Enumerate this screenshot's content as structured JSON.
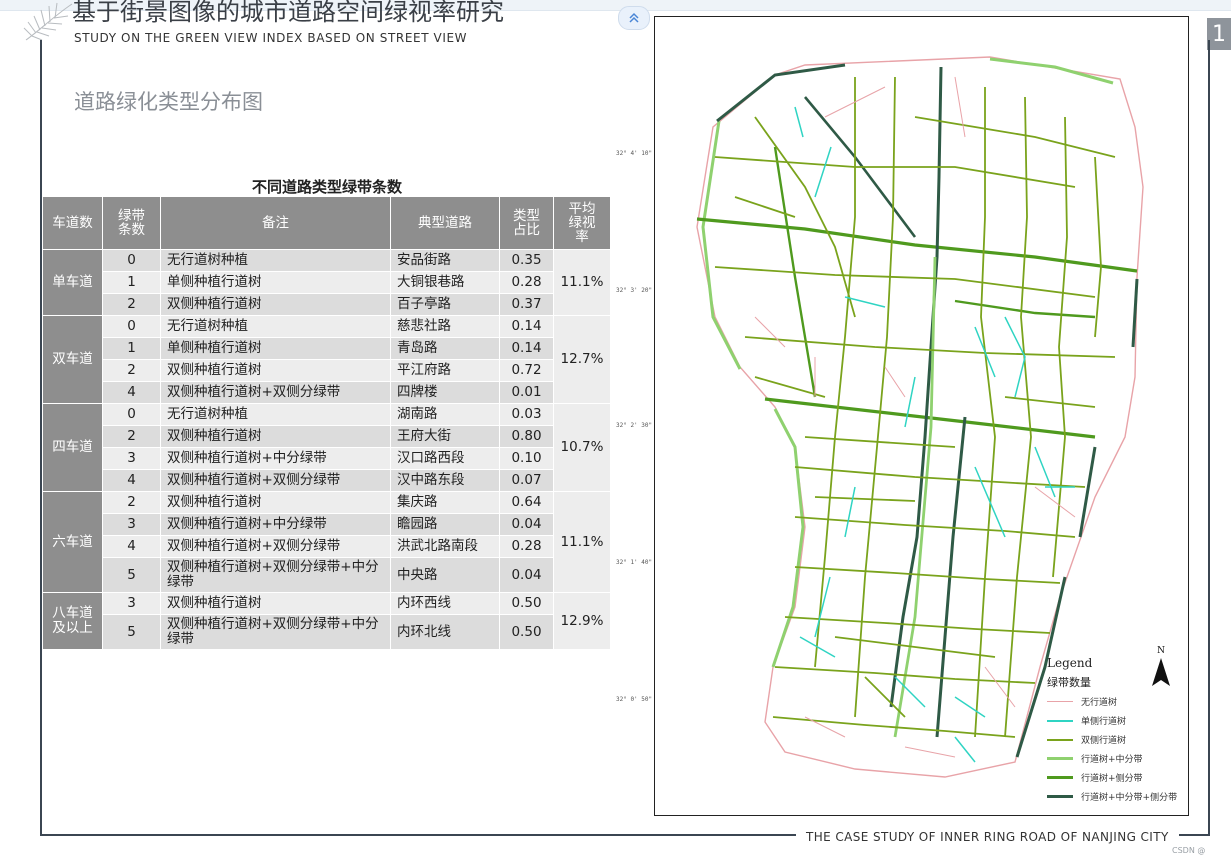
{
  "header": {
    "title_cn": "基于街景图像的城市道路空间绿视率研究",
    "title_en": "STUDY ON THE GREEN VIEW INDEX BASED ON STREET VIEW",
    "section_title": "道路绿化类型分布图",
    "page_badge": "1"
  },
  "table": {
    "title": "不同道路类型绿带条数",
    "headers": [
      "车道数",
      "绿带条数",
      "备注",
      "典型道路",
      "类型占比",
      "平均绿视率"
    ],
    "groups": [
      {
        "lane": "单车道",
        "avg": "11.1%",
        "rows": [
          {
            "belts": "0",
            "note": "无行道树种植",
            "road": "安品街路",
            "ratio": "0.35"
          },
          {
            "belts": "1",
            "note": "单侧种植行道树",
            "road": "大铜银巷路",
            "ratio": "0.28"
          },
          {
            "belts": "2",
            "note": "双侧种植行道树",
            "road": "百子亭路",
            "ratio": "0.37"
          }
        ]
      },
      {
        "lane": "双车道",
        "avg": "12.7%",
        "rows": [
          {
            "belts": "0",
            "note": "无行道树种植",
            "road": "慈悲社路",
            "ratio": "0.14"
          },
          {
            "belts": "1",
            "note": "单侧种植行道树",
            "road": "青岛路",
            "ratio": "0.14"
          },
          {
            "belts": "2",
            "note": "双侧种植行道树",
            "road": "平江府路",
            "ratio": "0.72"
          },
          {
            "belts": "4",
            "note": "双侧种植行道树+双侧分绿带",
            "road": "四牌楼",
            "ratio": "0.01"
          }
        ]
      },
      {
        "lane": "四车道",
        "avg": "10.7%",
        "rows": [
          {
            "belts": "0",
            "note": "无行道树种植",
            "road": "湖南路",
            "ratio": "0.03"
          },
          {
            "belts": "2",
            "note": "双侧种植行道树",
            "road": "王府大街",
            "ratio": "0.80"
          },
          {
            "belts": "3",
            "note": "双侧种植行道树+中分绿带",
            "road": "汉口路西段",
            "ratio": "0.10"
          },
          {
            "belts": "4",
            "note": "双侧种植行道树+双侧分绿带",
            "road": "汉中路东段",
            "ratio": "0.07"
          }
        ]
      },
      {
        "lane": "六车道",
        "avg": "11.1%",
        "rows": [
          {
            "belts": "2",
            "note": "双侧种植行道树",
            "road": "集庆路",
            "ratio": "0.64"
          },
          {
            "belts": "3",
            "note": "双侧种植行道树+中分绿带",
            "road": "瞻园路",
            "ratio": "0.04"
          },
          {
            "belts": "4",
            "note": "双侧种植行道树+双侧分绿带",
            "road": "洪武北路南段",
            "ratio": "0.28"
          },
          {
            "belts": "5",
            "note": "双侧种植行道树+双侧分绿带+中分绿带",
            "road": "中央路",
            "ratio": "0.04"
          }
        ]
      },
      {
        "lane": "八车道及以上",
        "avg": "12.9%",
        "rows": [
          {
            "belts": "3",
            "note": "双侧种植行道树",
            "road": "内环西线",
            "ratio": "0.50"
          },
          {
            "belts": "5",
            "note": "双侧种植行道树+双侧分绿带+中分绿带",
            "road": "内环北线",
            "ratio": "0.50"
          }
        ]
      }
    ]
  },
  "map": {
    "lat_labels": [
      "32° 4' 10\" N",
      "32° 3' 20\" N",
      "32° 2' 30\" N",
      "32° 1' 40\" N",
      "32° 0' 50\" N"
    ],
    "north_label": "N",
    "legend_title": "Legend",
    "legend_subtitle": "绿带数量",
    "legend": [
      {
        "label": "无行道树",
        "color": "#e8a3a8"
      },
      {
        "label": "单侧行道树",
        "color": "#2fd4c3"
      },
      {
        "label": "双侧行道树",
        "color": "#7aa31c"
      },
      {
        "label": "行道树+中分带",
        "color": "#8fd16f"
      },
      {
        "label": "行道树+侧分带",
        "color": "#4f9a1e"
      },
      {
        "label": "行道树+中分带+侧分带",
        "color": "#2f5a46"
      }
    ]
  },
  "footer": {
    "caption": "THE CASE STUDY OF INNER RING ROAD OF NANJING CITY",
    "watermark": "CSDN @"
  }
}
